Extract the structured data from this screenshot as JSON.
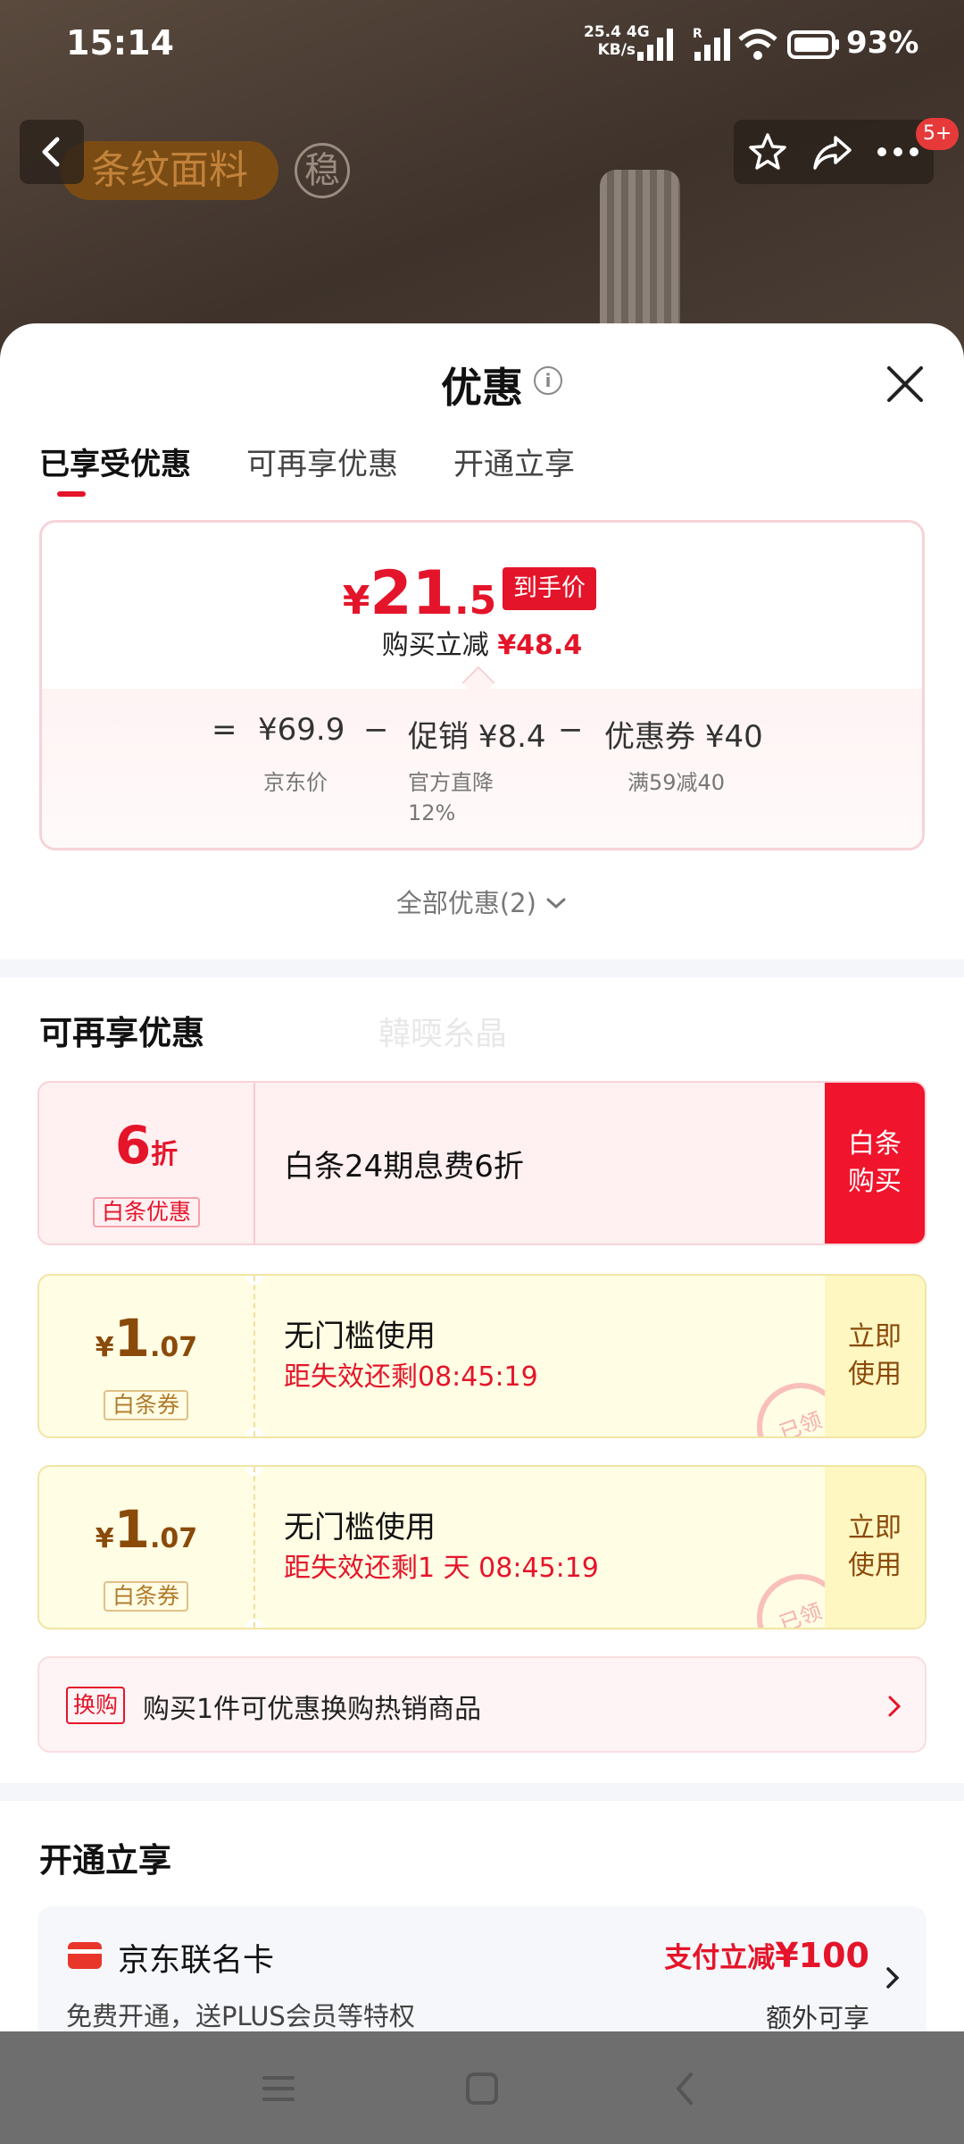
{
  "status_bar": {
    "time": "15:14",
    "net_speed_value": "25.4",
    "net_speed_unit": "KB/s",
    "net_type": "4G",
    "roaming": "R",
    "battery": "93%",
    "icons": [
      "signal-icon",
      "wifi-icon",
      "battery-icon"
    ]
  },
  "background_page": {
    "product_tag": "条纹面料",
    "badge": "稳",
    "notification_count": "5+",
    "icons": [
      "back-arrow-icon",
      "star-icon",
      "share-icon",
      "more-icon"
    ]
  },
  "sheet": {
    "title": "优惠",
    "info_icon": "i",
    "tabs": [
      {
        "label": "已享受优惠",
        "active": true
      },
      {
        "label": "可再享优惠",
        "active": false
      },
      {
        "label": "开通立享",
        "active": false
      }
    ],
    "price_card": {
      "currency": "¥",
      "price_integer": "21",
      "price_decimal": ".5",
      "price_tag": "到手价",
      "reduce_label": "购买立减",
      "reduce_amount": "¥48.4",
      "equals": "=",
      "minus": "−",
      "jd_price": "¥69.9",
      "jd_price_label": "京东价",
      "promo_label": "促销",
      "promo_amount": "¥8.4",
      "promo_desc_line1": "官方直降",
      "promo_desc_line2": "12%",
      "coupon_label": "优惠券",
      "coupon_amount": "¥40",
      "coupon_desc": "满59减40"
    },
    "all_offers": "全部优惠(2)",
    "section_more": {
      "title": "可再享优惠",
      "watermark": "韓㬉糸晶",
      "baitiao_offer": {
        "discount_number": "6",
        "discount_unit": "折",
        "label": "白条优惠",
        "description": "白条24期息费6折",
        "button_line1": "白条",
        "button_line2": "购买"
      },
      "coupons": [
        {
          "currency": "¥",
          "amount_integer": "1",
          "amount_decimal": ".07",
          "label": "白条券",
          "title": "无门槛使用",
          "timer": "距失效还剩08:45:19",
          "button_line1": "立即",
          "button_line2": "使用",
          "stamp": "已领"
        },
        {
          "currency": "¥",
          "amount_integer": "1",
          "amount_decimal": ".07",
          "label": "白条券",
          "title": "无门槛使用",
          "timer": "距失效还剩1 天 08:45:19",
          "button_line1": "立即",
          "button_line2": "使用",
          "stamp": "已领"
        }
      ],
      "exchange": {
        "tag": "换购",
        "text": "购买1件可优惠换购热销商品"
      }
    },
    "section_open": {
      "title": "开通立享",
      "card": {
        "name": "京东联名卡",
        "description": "免费开通，送PLUS会员等特权",
        "offer_prefix": "支付立减",
        "offer_amount": "¥100",
        "extra": "额外可享"
      }
    }
  },
  "nav_bar": {
    "icons": [
      "menu-icon",
      "home-icon",
      "back-icon"
    ]
  },
  "colors": {
    "accent_red": "#e4152a",
    "coupon_yellow": "#fffde4",
    "coupon_brown": "#8a4a0a"
  }
}
